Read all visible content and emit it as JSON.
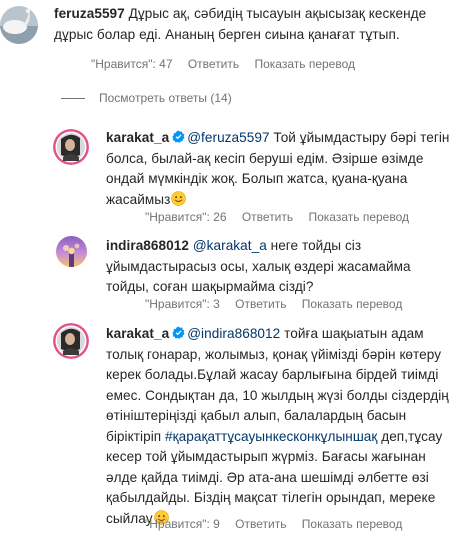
{
  "comments": [
    {
      "username": "feruza5597",
      "text": " Дұрыс ақ, сәбидің тысауын ақысызақ кескенде дұрыс болар еді. Ананың берген сиына қанағат тұтып.",
      "likes": "\"Нравится\": 47",
      "reply": "Ответить",
      "translate": "Показать перевод"
    },
    {
      "username": "karakat_a",
      "mention": "@feruza5597",
      "text": " Той ұйымдастыру бәрі тегін болса, былай-ақ кесіп беруші едім. Әзірше өзімде ондай мүмкіндік жоқ. Болып жатса, қуана-қуана жасаймыз",
      "likes": "\"Нравится\": 26",
      "reply": "Ответить",
      "translate": "Показать перевод"
    },
    {
      "username": "indira868012",
      "mention": "@karakat_a",
      "text": " неге тойды сіз ұйымдастырасыз осы, халық өздері жасамайма тойды, соған шақырмайма сізді?",
      "likes": "\"Нравится\": 3",
      "reply": "Ответить",
      "translate": "Показать перевод"
    },
    {
      "username": "karakat_a",
      "mention": "@indira868012",
      "text_before": " тойға шақыатын адам толық гонарар, жолымыз, қонақ үйімізді бәрін көтеру керек болады.Бұлай жасау барлығына бірдей тиімді емес. Сондықтан да, 10 жылдың жүзі болды сіздердің өтініштеріңізді қабыл алып, балалардың басын біріктіріп ",
      "hashtag": "#қарақаттұсауынкесконкұлыншақ",
      "text_after": " деп,тұсау кесер той ұйымдастырып жүрміз. Бағасы жағынан әлде қайда тиімді. Әр ата-ана шешімді әлбетте өзі қабылдайды. Біздің мақсат тілегін орындап, мереке сыйлау",
      "likes": "\"Нравится\": 9",
      "reply": "Ответить",
      "translate": "Показать перевод"
    }
  ],
  "view_replies_label": "Посмотреть ответы (14)",
  "icons": {
    "verified": "verified-badge-icon",
    "emoji": "smiling-face-emoji-icon"
  },
  "colors": {
    "text": "#262626",
    "meta": "#737373",
    "link": "#00376b",
    "verified": "#0095f6"
  }
}
